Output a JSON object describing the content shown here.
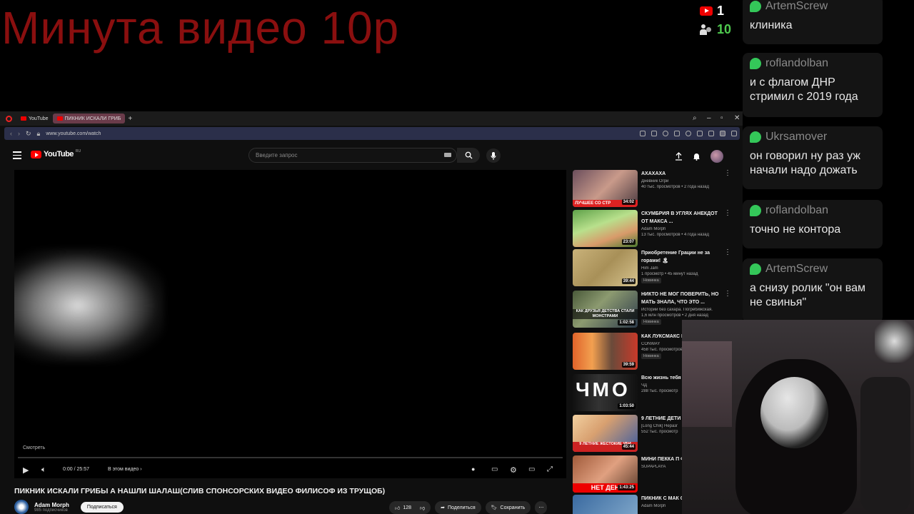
{
  "overlay": {
    "title": "Минута видео 10р",
    "youtube_count": "1",
    "viewers_count": "10"
  },
  "chat": [
    {
      "user": "ArtemScrew",
      "text": "клиника"
    },
    {
      "user": "roflandolban",
      "text": "и с флагом ДНР стримил с 2019 года"
    },
    {
      "user": "Ukrsamover",
      "text": "он говорил ну раз уж начали надо дожать"
    },
    {
      "user": "roflandolban",
      "text": "точно не контора"
    },
    {
      "user": "ArtemScrew",
      "text": "а снизу ролик \"он вам не свинья\""
    }
  ],
  "browser": {
    "tabs": [
      {
        "label": "YouTube"
      },
      {
        "label": "ПИКНИК ИСКАЛИ ГРИБ"
      }
    ],
    "url": "www.youtube.com/watch"
  },
  "youtube": {
    "logo_text": "YouTube",
    "logo_region": "RU",
    "search_placeholder": "Введите запрос"
  },
  "player": {
    "watch_label": "Смотреть",
    "time": "0:00 / 25:57",
    "chapters_label": "В этом видео",
    "progress": 0.0
  },
  "video": {
    "title": "ПИКНИК ИСКАЛИ ГРИБЫ А НАШЛИ ШАЛАШ(СЛИВ СПОНСОРСКИХ ВИДЕО ФИЛИСОФ ИЗ ТРУЩОБ)",
    "channel": "Adam Morph",
    "subscribers": "985 подписчиков",
    "subscribe_label": "Подписаться",
    "likes": "128",
    "share_label": "Поделиться",
    "save_label": "Сохранить"
  },
  "recommendations": [
    {
      "title": "АХАХАХА",
      "channel": "Дневник Огрй",
      "meta": "40 тыс. просмотров • 2 года назад",
      "duration": "34:02",
      "badge": "",
      "thumb_text": "ЛУЧШЕЕ СО СТР"
    },
    {
      "title": "СКУМБРИЯ В УГЛЯХ АНЕКДОТ ОТ МАКСА ...",
      "channel": "Adam Morph",
      "meta": "13 тыс. просмотров • 4 года назад",
      "duration": "23:07",
      "badge": "",
      "thumb_text": ""
    },
    {
      "title": "Приобретение Грации не за горами! 🏝",
      "channel": "Him Jam",
      "meta": "1 просмотр • 45 минут назад",
      "duration": "39:44",
      "badge": "Новинка",
      "thumb_text": ""
    },
    {
      "title": "НИКТО НЕ МОГ ПОВЕРИТЬ, НО МАТЬ ЗНАЛА, ЧТО ЭТО ...",
      "channel": "Истории без сахара. Погребижская.",
      "meta": "1,6 млн просмотров • 2 дня назад",
      "duration": "1:02:58",
      "badge": "Новинка",
      "thumb_text": "КАК ДРУЗЬЯ ДЕТСТВА СТАЛИ МОНСТРАМИ"
    },
    {
      "title": "КАК ЛУКСМАКС ИЗ НЕГО МОНСТ",
      "channel": "CONWAY",
      "meta": "458 тыс. просмотров",
      "duration": "39:59",
      "badge": "Новинка",
      "thumb_text": ""
    },
    {
      "title": "Всю жизнь тебя ненавидеть себ",
      "channel": "ЧД",
      "meta": "288 тыс. просмотр",
      "duration": "1:03:50",
      "badge": "",
      "thumb_text": "ЧМО"
    },
    {
      "title": "9 ЛЕТНИЕ ДЕТИ ЖЕСТОКИМИ УБ",
      "channel": "[Long Chik] Неразг",
      "meta": "552 тыс. просмотр",
      "duration": "45:44",
      "badge": "",
      "thumb_text": "9 ЛЕТНИЕ ЖЕСТОКИЕ УБИ"
    },
    {
      "title": "МИНИ ПЕККА П ФИТНЕС ИНДУС",
      "channel": "SUPAPLAYA",
      "meta": "",
      "duration": "1:43:25",
      "badge": "",
      "thumb_text": "НЕТ ДЕН"
    },
    {
      "title": "ПИКНИК С МАК ОВОЩНОЕ РАГУ",
      "channel": "Adam Morph",
      "meta": "",
      "duration": "",
      "badge": "",
      "thumb_text": ""
    }
  ]
}
